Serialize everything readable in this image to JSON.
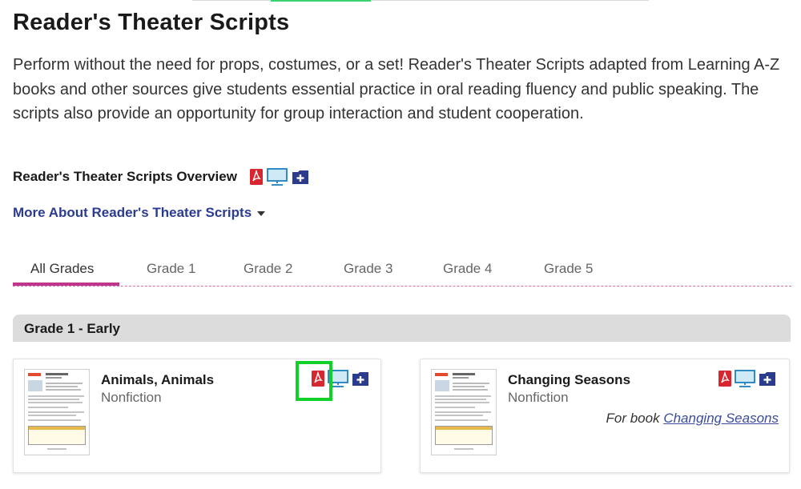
{
  "page": {
    "title": "Reader's Theater Scripts",
    "intro": "Perform without the need for props, costumes, or a set! Reader's Theater Scripts adapted from Learning A-Z books and other sources give students essential practice in oral reading fluency and public speaking. The scripts also provide an opportunity for group interaction and student cooperation."
  },
  "overview": {
    "label": "Reader's Theater Scripts Overview",
    "icons": [
      "pdf-icon",
      "projector-icon",
      "add-to-folder-icon"
    ]
  },
  "more_about": {
    "label": "More About Reader's Theater Scripts",
    "icon": "caret-down-icon"
  },
  "tabs": {
    "items": [
      "All Grades",
      "Grade 1",
      "Grade 2",
      "Grade 3",
      "Grade 4",
      "Grade 5"
    ],
    "active": "All Grades"
  },
  "grade_section": {
    "header": "Grade 1 - Early"
  },
  "cards": [
    {
      "title": "Animals, Animals",
      "type": "Nonfiction",
      "for_book_prefix": "",
      "for_book_title": ""
    },
    {
      "title": "Changing Seasons",
      "type": "Nonfiction",
      "for_book_prefix": "For book",
      "for_book_title": "Changing Seasons"
    }
  ],
  "colors": {
    "pdf": "#d7262f",
    "projector": "#1f7fbf",
    "folder": "#2b3c8f",
    "tab_active_underline": "#c1368d",
    "link": "#2b3c8f",
    "highlight": "#10d02a"
  }
}
